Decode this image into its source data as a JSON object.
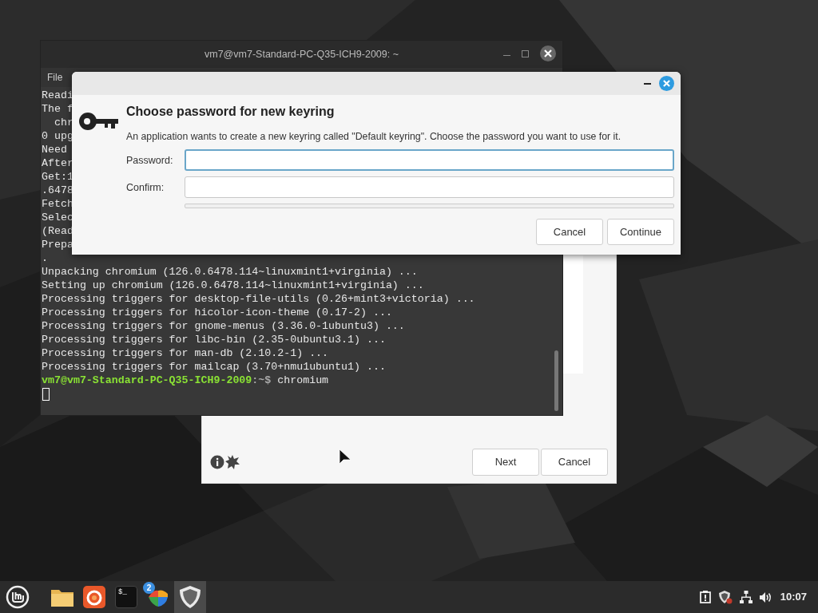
{
  "terminal_window": {
    "title": "vm7@vm7-Standard-PC-Q35-ICH9-2009: ~",
    "menu": [
      "File"
    ],
    "lines": [
      {
        "kind": "output",
        "text": "Readi"
      },
      {
        "kind": "output",
        "text": "The f"
      },
      {
        "kind": "output",
        "text": "  chr"
      },
      {
        "kind": "output",
        "text": "0 upg"
      },
      {
        "kind": "output",
        "text": "Need"
      },
      {
        "kind": "output",
        "text": "After"
      },
      {
        "kind": "output",
        "text": "Get:1"
      },
      {
        "kind": "output",
        "text": ".6478"
      },
      {
        "kind": "output",
        "text": "Fetch"
      },
      {
        "kind": "output",
        "text": "Selec"
      },
      {
        "kind": "output",
        "text": "(Read"
      },
      {
        "kind": "output",
        "text": "Prepa"
      },
      {
        "kind": "output",
        "text": "."
      },
      {
        "kind": "output",
        "text": "Unpacking chromium (126.0.6478.114~linuxmint1+virginia) ..."
      },
      {
        "kind": "output",
        "text": "Setting up chromium (126.0.6478.114~linuxmint1+virginia) ..."
      },
      {
        "kind": "output",
        "text": "Processing triggers for desktop-file-utils (0.26+mint3+victoria) ..."
      },
      {
        "kind": "output",
        "text": "Processing triggers for hicolor-icon-theme (0.17-2) ..."
      },
      {
        "kind": "output",
        "text": "Processing triggers for gnome-menus (3.36.0-1ubuntu3) ..."
      },
      {
        "kind": "output",
        "text": "Processing triggers for libc-bin (2.35-0ubuntu3.1) ..."
      },
      {
        "kind": "output",
        "text": "Processing triggers for man-db (2.10.2-1) ..."
      },
      {
        "kind": "output",
        "text": "Processing triggers for mailcap (3.70+nmu1ubuntu1) ..."
      },
      {
        "kind": "prompt",
        "user_host": "vm7@vm7-Standard-PC-Q35-ICH9-2009",
        "path": ":~$",
        "command": "chromium"
      },
      {
        "kind": "cursor"
      }
    ]
  },
  "installer_window": {
    "buttons": [
      {
        "label": "Next"
      },
      {
        "label": "Cancel"
      }
    ]
  },
  "keyring_dialog": {
    "title": "Choose password for new keyring",
    "description": "An application wants to create a new keyring called \"Default keyring\". Choose the password you want to use for it.",
    "fields": [
      {
        "label": "Password:",
        "focused": true
      },
      {
        "label": "Confirm:",
        "focused": false
      }
    ],
    "buttons": [
      "Cancel",
      "Continue"
    ]
  },
  "taskbar": {
    "apps": [
      {
        "kind": "folder",
        "active": false
      },
      {
        "kind": "browser",
        "active": false
      },
      {
        "kind": "terminal",
        "glyph": "$_",
        "active": false
      },
      {
        "kind": "updates",
        "badge": "2",
        "active": false
      },
      {
        "kind": "shield",
        "active": true
      }
    ],
    "clock": "10:07"
  }
}
